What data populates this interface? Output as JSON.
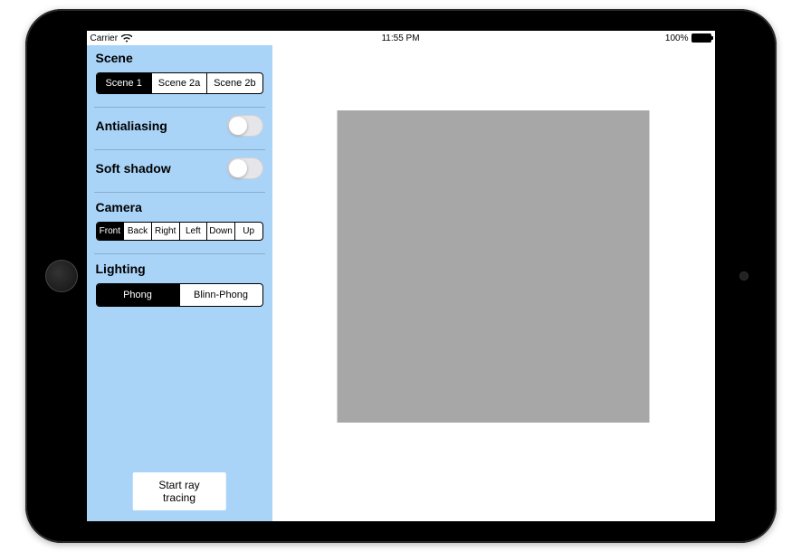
{
  "statusbar": {
    "carrier": "Carrier",
    "time": "11:55 PM",
    "battery_pct": "100%"
  },
  "sidebar": {
    "scene": {
      "title": "Scene",
      "options": [
        "Scene 1",
        "Scene 2a",
        "Scene 2b"
      ],
      "selected_index": 0
    },
    "antialiasing": {
      "label": "Antialiasing",
      "on": false
    },
    "soft_shadow": {
      "label": "Soft shadow",
      "on": false
    },
    "camera": {
      "title": "Camera",
      "options": [
        "Front",
        "Back",
        "Right",
        "Left",
        "Down",
        "Up"
      ],
      "selected_index": 0
    },
    "lighting": {
      "title": "Lighting",
      "options": [
        "Phong",
        "Blinn-Phong"
      ],
      "selected_index": 0
    },
    "start_button": "Start ray tracing"
  }
}
